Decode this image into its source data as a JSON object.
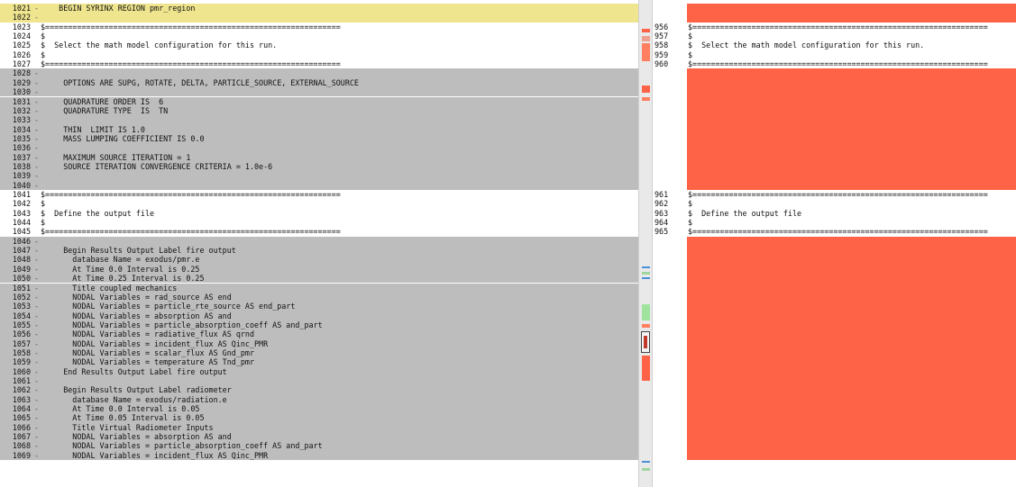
{
  "left": {
    "lines": [
      {
        "n": "1021",
        "m": "-",
        "t": "    BEGIN SYRINX REGION pmr_region",
        "bg": "yellow"
      },
      {
        "n": "1022",
        "m": "-",
        "t": "",
        "bg": "yellow"
      },
      {
        "n": "1023",
        "m": "",
        "t": "$=================================================================",
        "bg": ""
      },
      {
        "n": "1024",
        "m": "",
        "t": "$",
        "bg": ""
      },
      {
        "n": "1025",
        "m": "",
        "t": "$  Select the math model configuration for this run.",
        "bg": ""
      },
      {
        "n": "1026",
        "m": "",
        "t": "$",
        "bg": ""
      },
      {
        "n": "1027",
        "m": "",
        "t": "$=================================================================",
        "bg": ""
      },
      {
        "n": "1028",
        "m": "-",
        "t": "",
        "bg": "gray"
      },
      {
        "n": "1029",
        "m": "-",
        "t": "     OPTIONS ARE SUPG, ROTATE, DELTA, PARTICLE_SOURCE, EXTERNAL_SOURCE",
        "bg": "gray"
      },
      {
        "n": "1030",
        "m": "-",
        "t": "",
        "bg": "gray"
      },
      {
        "n": "1031",
        "m": "-",
        "t": "     QUADRATURE ORDER IS  6",
        "bg": "gray"
      },
      {
        "n": "1032",
        "m": "-",
        "t": "     QUADRATURE TYPE  IS  TN",
        "bg": "gray"
      },
      {
        "n": "1033",
        "m": "-",
        "t": "",
        "bg": "gray"
      },
      {
        "n": "1034",
        "m": "-",
        "t": "     THIN  LIMIT IS 1.0",
        "bg": "gray"
      },
      {
        "n": "1035",
        "m": "-",
        "t": "     MASS LUMPING COEFFICIENT IS 0.0",
        "bg": "gray"
      },
      {
        "n": "1036",
        "m": "-",
        "t": "",
        "bg": "gray"
      },
      {
        "n": "1037",
        "m": "-",
        "t": "     MAXIMUM SOURCE ITERATION = 1",
        "bg": "gray"
      },
      {
        "n": "1038",
        "m": "-",
        "t": "     SOURCE ITERATION CONVERGENCE CRITERIA = 1.0e-6",
        "bg": "gray"
      },
      {
        "n": "1039",
        "m": "-",
        "t": "",
        "bg": "gray"
      },
      {
        "n": "1040",
        "m": "-",
        "t": "",
        "bg": "gray"
      },
      {
        "n": "1041",
        "m": "",
        "t": "$=================================================================",
        "bg": ""
      },
      {
        "n": "1042",
        "m": "",
        "t": "$",
        "bg": ""
      },
      {
        "n": "1043",
        "m": "",
        "t": "$  Define the output file",
        "bg": ""
      },
      {
        "n": "1044",
        "m": "",
        "t": "$",
        "bg": ""
      },
      {
        "n": "1045",
        "m": "",
        "t": "$=================================================================",
        "bg": ""
      },
      {
        "n": "1046",
        "m": "-",
        "t": "",
        "bg": "gray"
      },
      {
        "n": "1047",
        "m": "-",
        "t": "     Begin Results Output Label fire output",
        "bg": "gray"
      },
      {
        "n": "1048",
        "m": "-",
        "t": "       database Name = exodus/pmr.e",
        "bg": "gray"
      },
      {
        "n": "1049",
        "m": "-",
        "t": "       At Time 0.0 Interval is 0.25",
        "bg": "gray"
      },
      {
        "n": "1050",
        "m": "-",
        "t": "       At Time 0.25 Interval is 0.25",
        "bg": "gray"
      },
      {
        "n": "1051",
        "m": "-",
        "t": "       Title coupled mechanics",
        "bg": "gray"
      },
      {
        "n": "1052",
        "m": "-",
        "t": "       NODAL Variables = rad_source AS end",
        "bg": "gray"
      },
      {
        "n": "1053",
        "m": "-",
        "t": "       NODAL Variables = particle_rte_source AS end_part",
        "bg": "gray"
      },
      {
        "n": "1054",
        "m": "-",
        "t": "       NODAL Variables = absorption AS and",
        "bg": "gray"
      },
      {
        "n": "1055",
        "m": "-",
        "t": "       NODAL Variables = particle_absorption_coeff AS and_part",
        "bg": "gray"
      },
      {
        "n": "1056",
        "m": "-",
        "t": "       NODAL Variables = radiative_flux AS qrnd",
        "bg": "gray"
      },
      {
        "n": "1057",
        "m": "-",
        "t": "       NODAL Variables = incident_flux AS Qinc_PMR",
        "bg": "gray"
      },
      {
        "n": "1058",
        "m": "-",
        "t": "       NODAL Variables = scalar_flux AS Gnd_pmr",
        "bg": "gray"
      },
      {
        "n": "1059",
        "m": "-",
        "t": "       NODAL Variables = temperature AS Tnd_pmr",
        "bg": "gray"
      },
      {
        "n": "1060",
        "m": "-",
        "t": "     End Results Output Label fire output",
        "bg": "gray"
      },
      {
        "n": "1061",
        "m": "-",
        "t": "",
        "bg": "gray"
      },
      {
        "n": "1062",
        "m": "-",
        "t": "     Begin Results Output Label radiometer",
        "bg": "gray"
      },
      {
        "n": "1063",
        "m": "-",
        "t": "       database Name = exodus/radiation.e",
        "bg": "gray"
      },
      {
        "n": "1064",
        "m": "-",
        "t": "       At Time 0.0 Interval is 0.05",
        "bg": "gray"
      },
      {
        "n": "1065",
        "m": "-",
        "t": "       At Time 0.05 Interval is 0.05",
        "bg": "gray"
      },
      {
        "n": "1066",
        "m": "-",
        "t": "       Title Virtual Radiometer Inputs",
        "bg": "gray"
      },
      {
        "n": "1067",
        "m": "-",
        "t": "       NODAL Variables = absorption AS and",
        "bg": "gray"
      },
      {
        "n": "1068",
        "m": "-",
        "t": "       NODAL Variables = particle_absorption_coeff AS and_part",
        "bg": "gray"
      },
      {
        "n": "1069",
        "m": "-",
        "t": "       NODAL Variables = incident_flux AS Qinc_PMR",
        "bg": "gray"
      }
    ]
  },
  "right": {
    "lines": [
      {
        "n": "956",
        "t": "$================================================================="
      },
      {
        "n": "957",
        "t": "$"
      },
      {
        "n": "958",
        "t": "$  Select the math model configuration for this run."
      },
      {
        "n": "959",
        "t": "$"
      },
      {
        "n": "960",
        "t": "$================================================================="
      },
      {
        "n": "961",
        "t": "$================================================================="
      },
      {
        "n": "962",
        "t": "$"
      },
      {
        "n": "963",
        "t": "$  Define the output file"
      },
      {
        "n": "964",
        "t": "$"
      },
      {
        "n": "965",
        "t": "$================================================================="
      }
    ]
  },
  "colors": {
    "removed": "#ff6347",
    "gray": "#bdbdbd",
    "yellow": "#efe58e"
  }
}
